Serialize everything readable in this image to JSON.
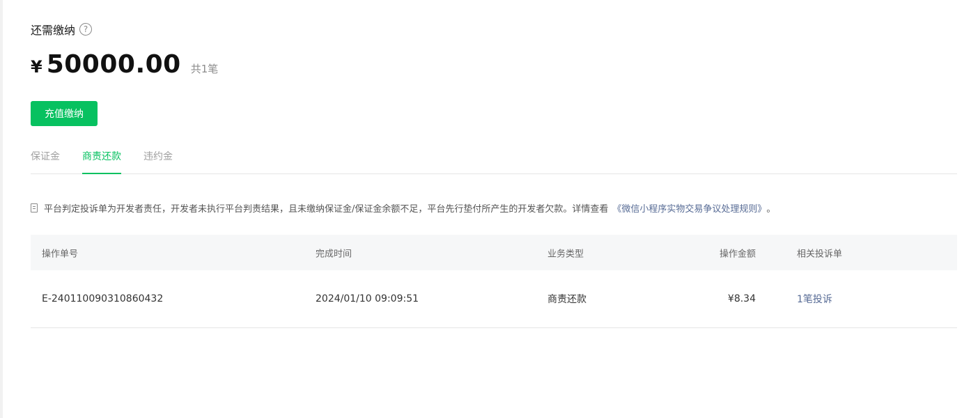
{
  "due": {
    "title": "还需缴纳",
    "help_icon": "?",
    "currency": "¥",
    "amount": "50000.00",
    "count": "共1笔"
  },
  "actions": {
    "recharge_label": "充值缴纳"
  },
  "tabs": [
    {
      "label": "保证金",
      "active": false
    },
    {
      "label": "商责还款",
      "active": true
    },
    {
      "label": "违约金",
      "active": false
    }
  ],
  "notice": {
    "text": "平台判定投诉单为开发者责任，开发者未执行平台判责结果，且未缴纳保证金/保证金余额不足，平台先行垫付所产生的开发者欠款。详情查看",
    "link": "《微信小程序实物交易争议处理规则》",
    "suffix": "。"
  },
  "table": {
    "headers": [
      "操作单号",
      "完成时间",
      "业务类型",
      "操作金额",
      "相关投诉单"
    ],
    "rows": [
      {
        "order_id": "E-240110090310860432",
        "completed_at": "2024/01/10 09:09:51",
        "type": "商责还款",
        "amount": "¥8.34",
        "complaints": "1笔投诉"
      }
    ]
  },
  "colors": {
    "accent": "#07c160",
    "link": "#576b95"
  }
}
